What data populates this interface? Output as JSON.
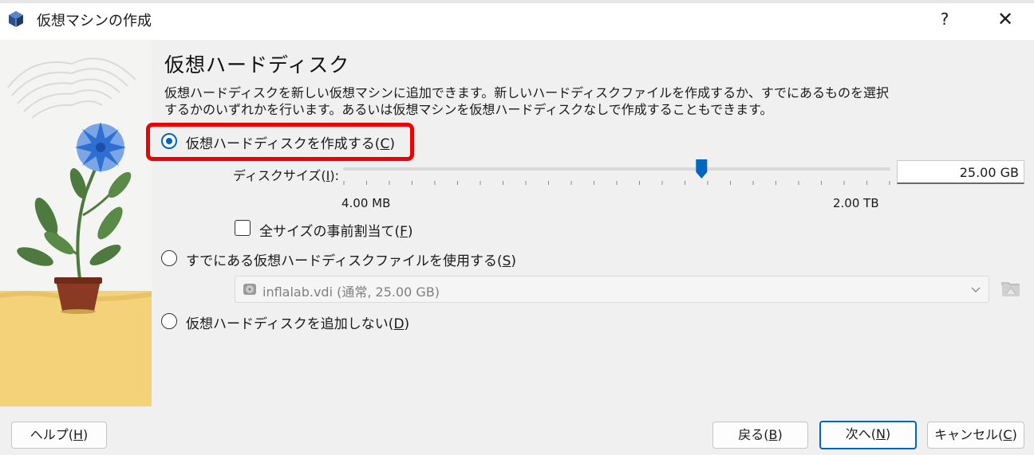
{
  "window": {
    "title": "仮想マシンの作成",
    "help_label": "?",
    "close_label": "✕"
  },
  "page": {
    "heading": "仮想ハードディスク",
    "description_line1": "仮想ハードディスクを新しい仮想マシンに追加できます。新しいハードディスクファイルを作成するか、すでにあるものを選択",
    "description_line2": "するかのいずれかを行います。あるいは仮想マシンを仮想ハードディスクなしで作成することもできます。"
  },
  "options": {
    "create": {
      "label": "仮想ハードディスクを作成する(",
      "key": "C",
      "suffix": ")",
      "selected": true
    },
    "existing": {
      "label": "すでにある仮想ハードディスクファイルを使用する(",
      "key": "S",
      "suffix": ")",
      "selected": false
    },
    "none": {
      "label": "仮想ハードディスクを追加しない(",
      "key": "D",
      "suffix": ")",
      "selected": false
    }
  },
  "disk_size": {
    "label_prefix": "ディスクサイズ(",
    "label_key": "I",
    "label_suffix": "):",
    "value": "25.00 GB",
    "min_label": "4.00 MB",
    "max_label": "2.00 TB",
    "slider_fraction": 0.655
  },
  "preallocate": {
    "label": "全サイズの事前割当て(",
    "key": "F",
    "suffix": ")",
    "checked": false
  },
  "existing_file": {
    "value": "inflalab.vdi (通常, 25.00 GB)"
  },
  "buttons": {
    "help": {
      "label": "ヘルプ(",
      "key": "H",
      "suffix": ")"
    },
    "back": {
      "label": "戻る(",
      "key": "B",
      "suffix": ")"
    },
    "next": {
      "label": "次へ(",
      "key": "N",
      "suffix": ")"
    },
    "cancel": {
      "label": "キャンセル(",
      "key": "C",
      "suffix": ")"
    }
  },
  "colors": {
    "accent": "#0067c0",
    "highlight_box": "#ee0000",
    "illustration_yellow": "#f3d27a",
    "flower_blue": "#2f6fd1",
    "leaf_green": "#4f7a3f",
    "pot_brown": "#8a3a22"
  }
}
